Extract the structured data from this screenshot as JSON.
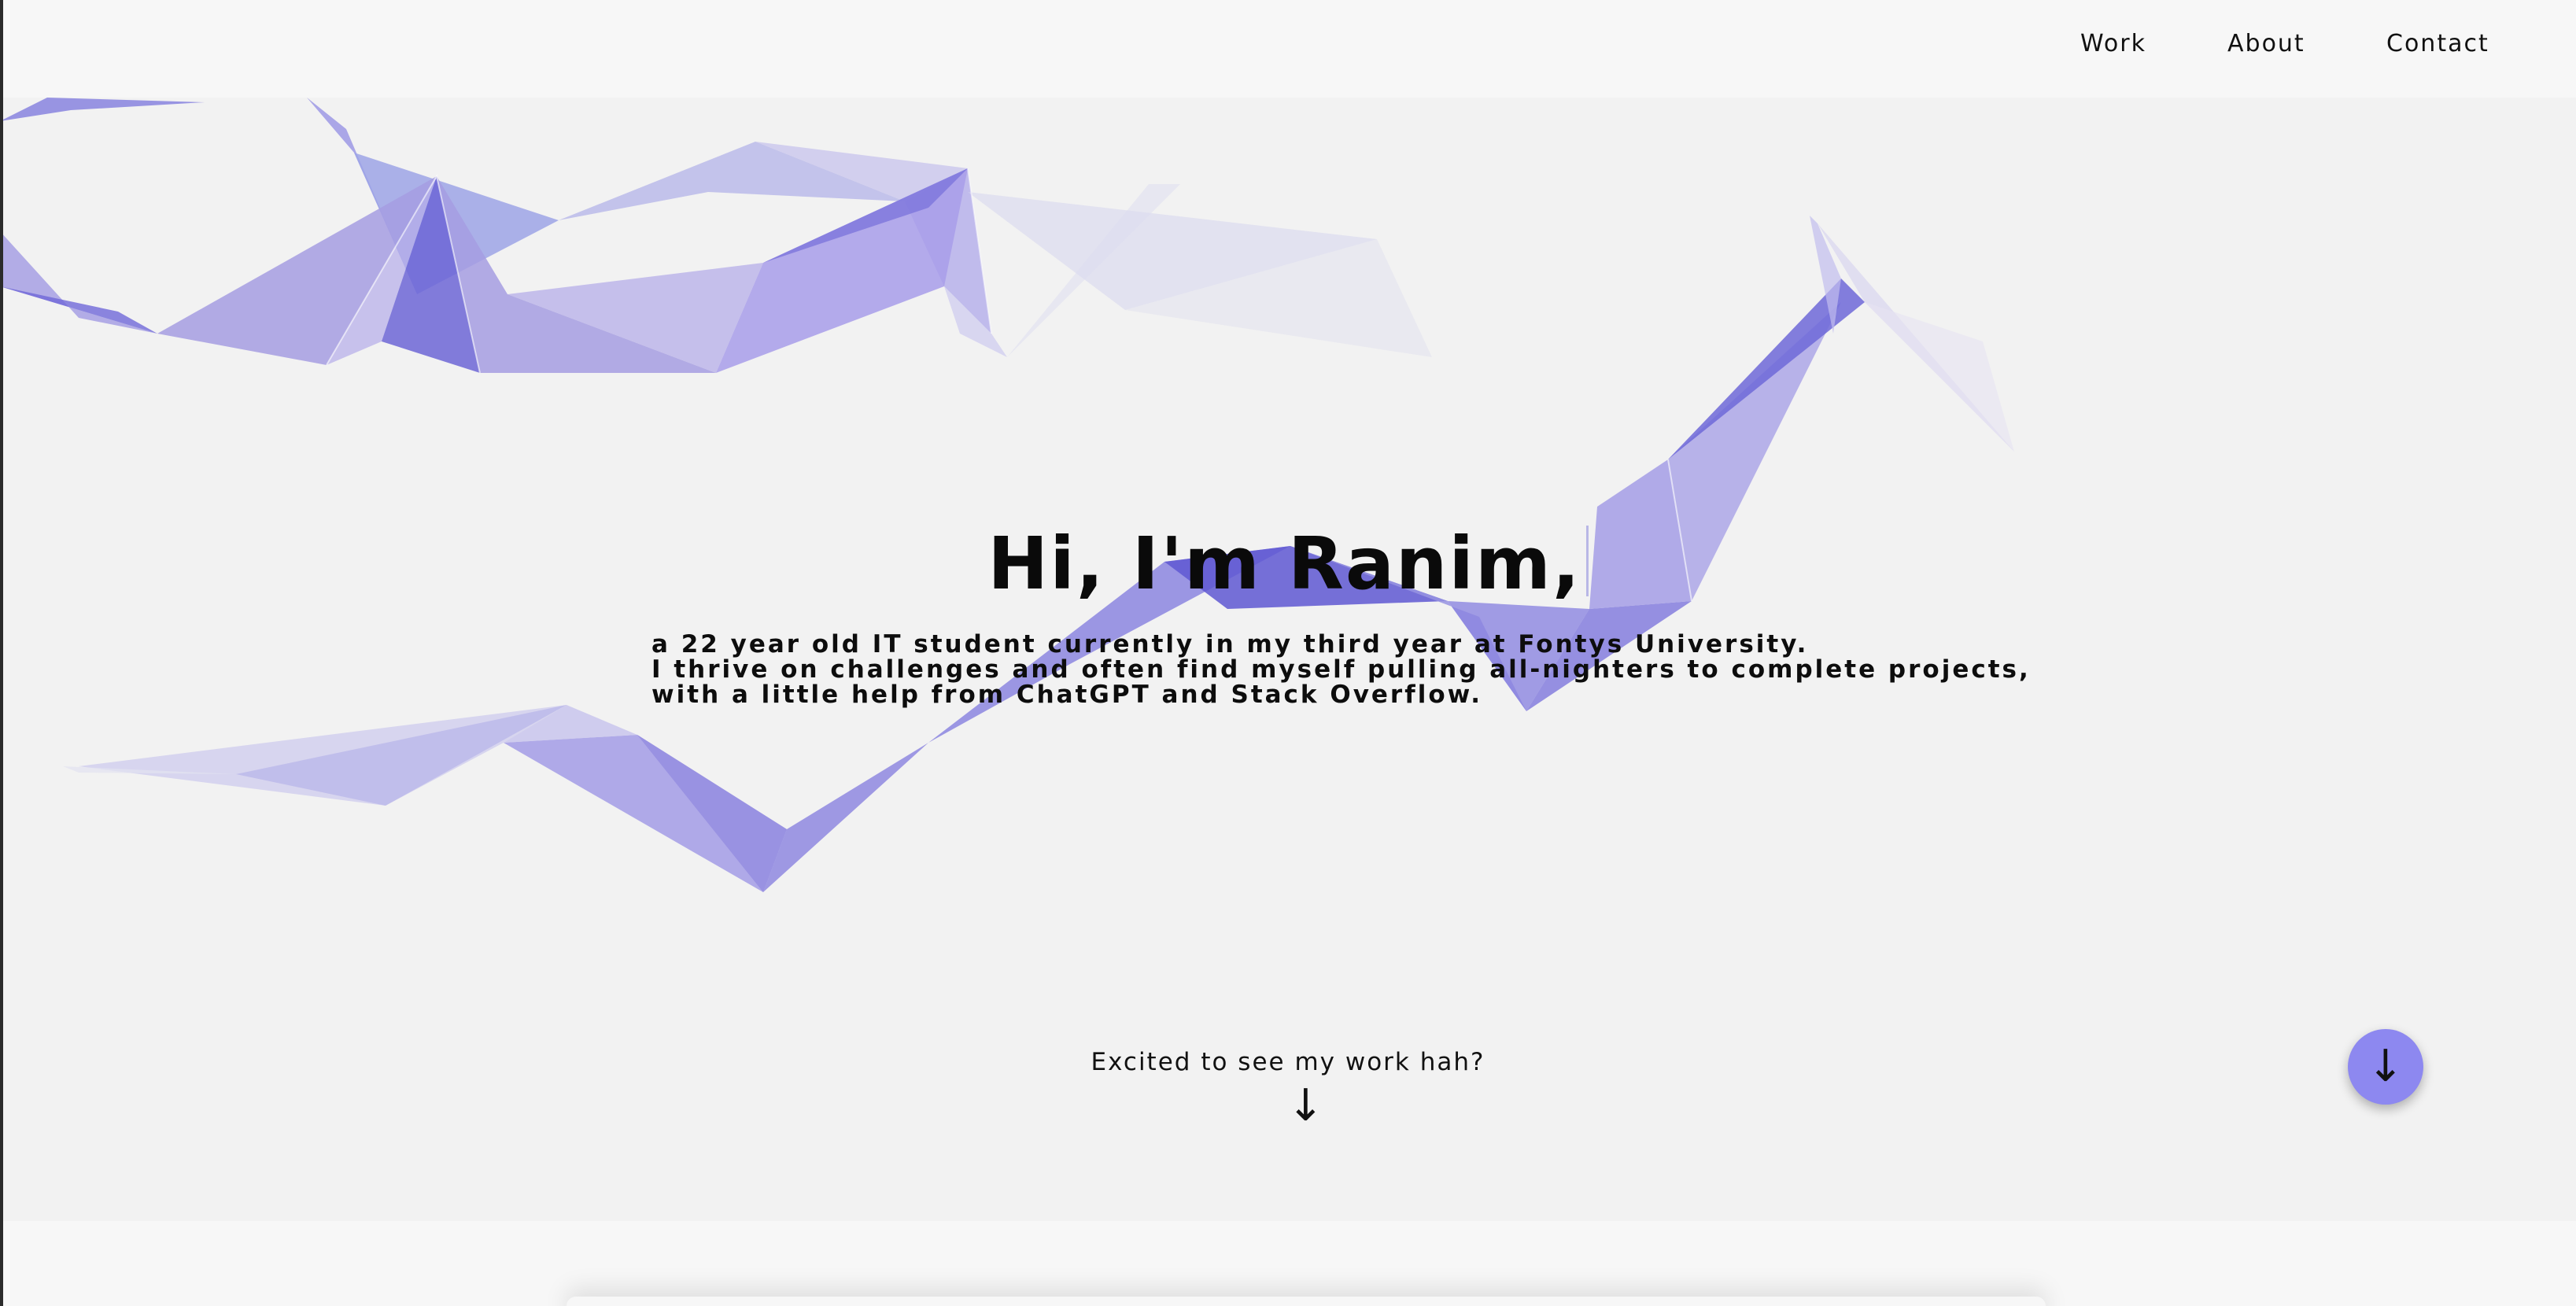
{
  "nav": {
    "items": [
      {
        "label": "Work"
      },
      {
        "label": "About"
      },
      {
        "label": "Contact"
      }
    ]
  },
  "hero": {
    "title": "Hi, I'm Ranim,",
    "description": [
      "a 22 year old IT student currently in my third year at Fontys University.",
      "I thrive on challenges and often find myself pulling all-nighters to complete projects,",
      "with a little help from ChatGPT and Stack Overflow."
    ],
    "cta_text": "Excited to see my work hah?",
    "cta_arrow": "↓"
  },
  "scroll_button": {
    "icon": "arrow-down-icon",
    "glyph": "↓"
  },
  "colors": {
    "accent": "#8d88f0",
    "ribbon_dark": "#6c66d6",
    "ribbon_mid": "#a79ee6",
    "ribbon_light": "#c8c5ee",
    "background": "#f2f2f2",
    "navbar": "#f7f7f7"
  }
}
